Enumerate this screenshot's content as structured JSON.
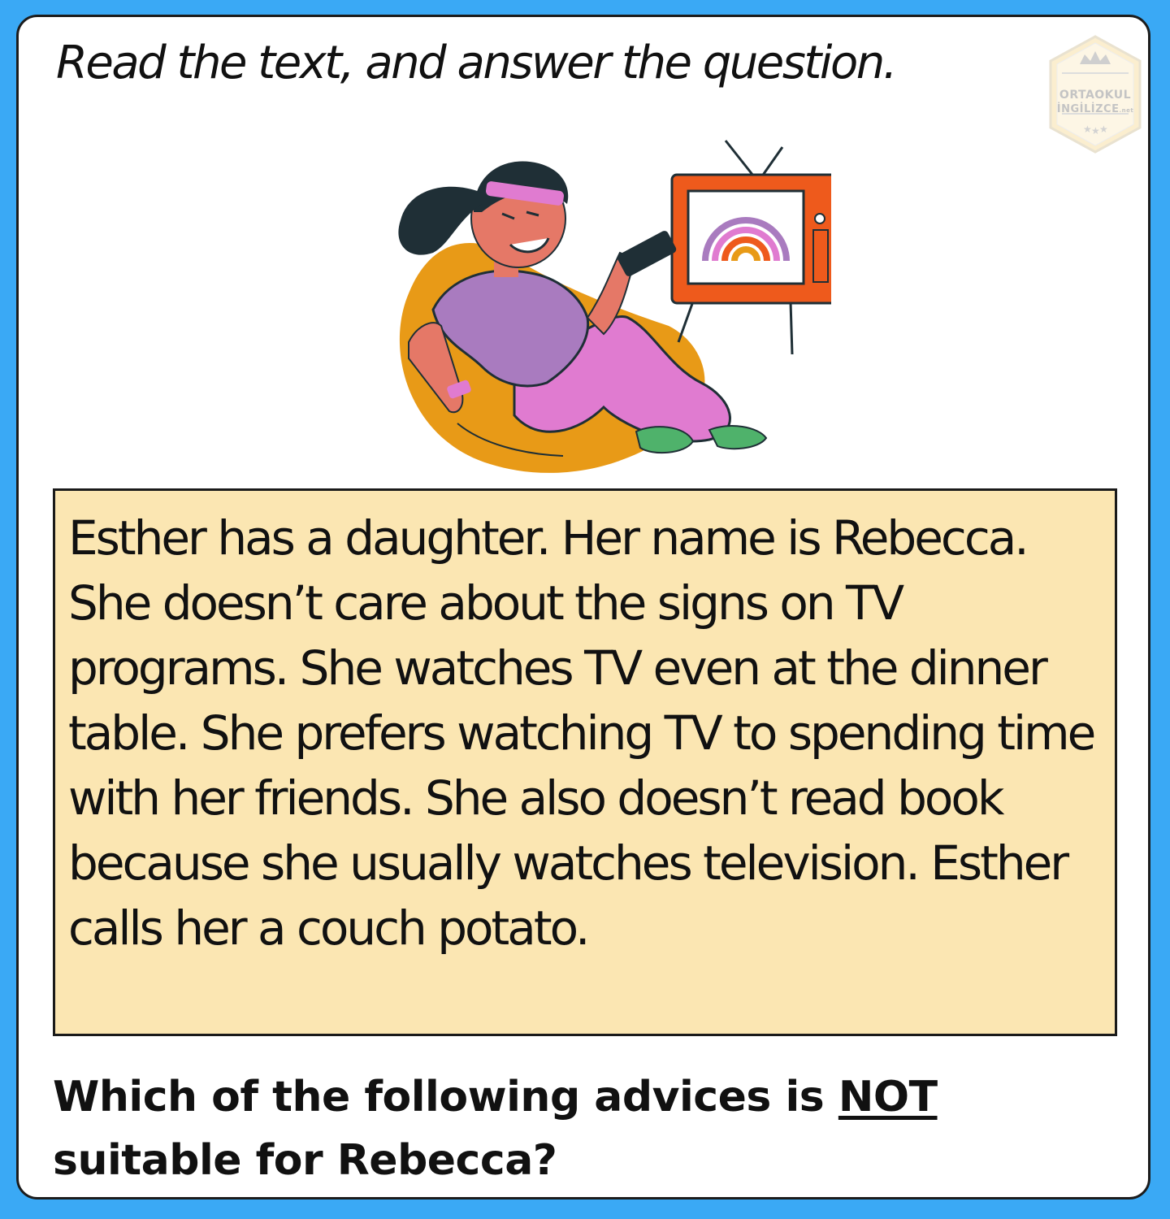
{
  "instruction": "Read the text, and answer the question.",
  "logo": {
    "line1": "ORTAOKUL",
    "line2": "İNGİLİZCE",
    "suffix": ".net"
  },
  "illustration": {
    "description_icon": "girl-watching-tv-illustration",
    "colors": {
      "beanbag": "#e89a17",
      "tv_body": "#ee5a1c",
      "shirt": "#a97bbf",
      "pants": "#e07bd0",
      "skin": "#e57867",
      "hair": "#1f2f36",
      "shoes": "#4fb26b"
    }
  },
  "passage": {
    "text": "Esther has a daughter. Her name is Rebecca. She doesn’t care about the signs on TV programs. She watches TV even at the dinner table. She prefers watching TV to spending time with her friends. She also doesn’t read book because she usually watches television. Esther calls her a couch potato."
  },
  "question": {
    "before": "Which of the following advices is ",
    "emphasis": "NOT",
    "after": " suitable for Rebecca?"
  },
  "colors": {
    "background": "#3aa9f5",
    "card": "#ffffff",
    "passage_box": "#fbe6b2",
    "text": "#111111"
  }
}
